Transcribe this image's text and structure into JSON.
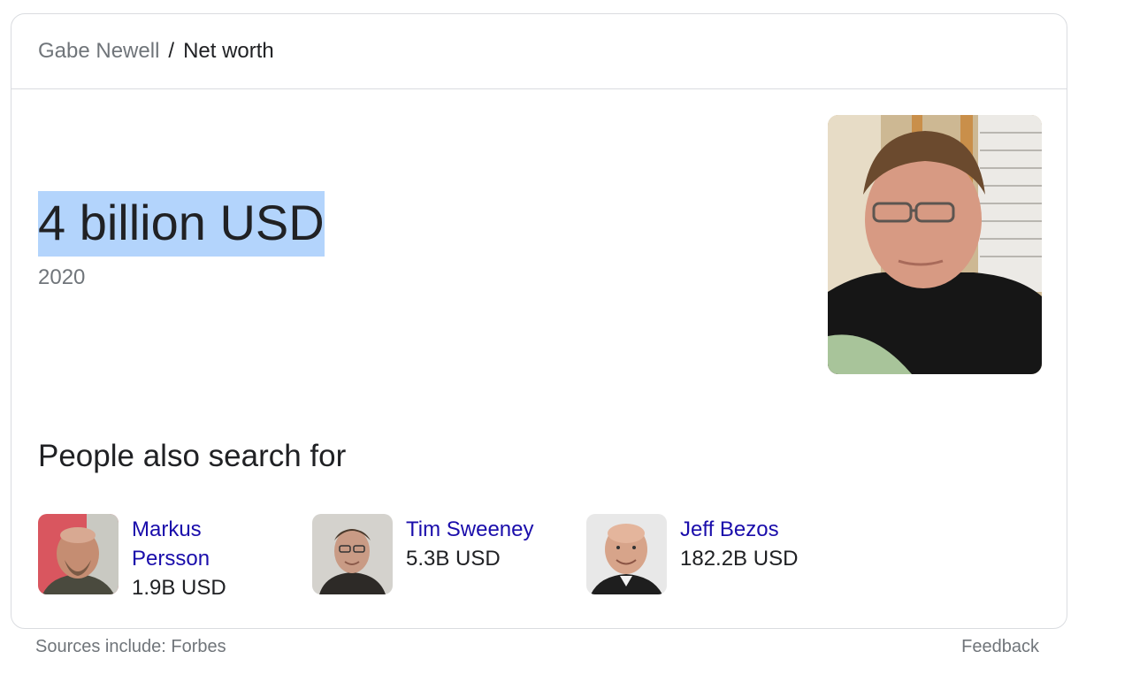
{
  "breadcrumb": {
    "parent": "Gabe Newell",
    "separator": "/",
    "current": "Net worth"
  },
  "answer": {
    "value": "4 billion USD",
    "year": "2020",
    "highlight_color": "#b3d4fc"
  },
  "people_also_search": {
    "title": "People also search for",
    "items": [
      {
        "name": "Markus Persson",
        "value": "1.9B USD"
      },
      {
        "name": "Tim Sweeney",
        "value": "5.3B USD"
      },
      {
        "name": "Jeff Bezos",
        "value": "182.2B USD"
      }
    ]
  },
  "footer": {
    "sources": "Sources include: Forbes",
    "feedback": "Feedback"
  },
  "colors": {
    "link": "#1a0dab",
    "text": "#202124",
    "muted": "#70757a",
    "border": "#dadce0"
  }
}
